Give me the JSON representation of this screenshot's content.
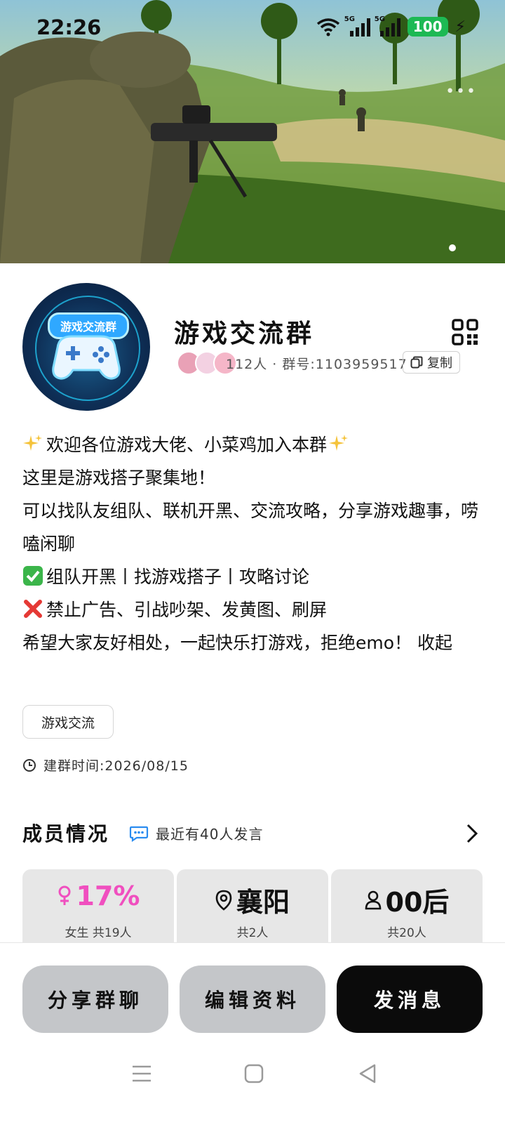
{
  "status": {
    "time": "22:26",
    "network1": "5G",
    "network2": "5G",
    "battery": "100"
  },
  "banner": {
    "more": "•••"
  },
  "group": {
    "title": "游戏交流群",
    "avatar_text": "游戏交流群",
    "meta": "112人 · 群号:1103959517",
    "copy_label": "复制"
  },
  "description": {
    "line1": "欢迎各位游戏大佬、小菜鸡加入本群",
    "line2": "这里是游戏搭子聚集地！",
    "line3": "可以找队友组队、联机开黑、交流攻略，分享游戏趣事，唠嗑闲聊",
    "line4": "组队开黑丨找游戏搭子丨攻略讨论",
    "line5": "禁止广告、引战吵架、发黄图、刷屏",
    "line6": "希望大家友好相处，一起快乐打游戏，拒绝emo！ 收起"
  },
  "tag": "游戏交流",
  "created": "建群时间:2026/08/15",
  "members": {
    "title": "成员情况",
    "subtitle": "最近有40人发言",
    "stats": [
      {
        "value": "17%",
        "caption": "女生 共19人"
      },
      {
        "value": "襄阳",
        "caption": "共2人"
      },
      {
        "value": "00后",
        "caption": "共20人"
      }
    ]
  },
  "actions": {
    "share": "分享群聊",
    "edit": "编辑资料",
    "message": "发消息"
  },
  "colors": {
    "accent_pink": "#f04fbf",
    "battery_green": "#1db954",
    "primary_button": "#0b0b0b"
  }
}
